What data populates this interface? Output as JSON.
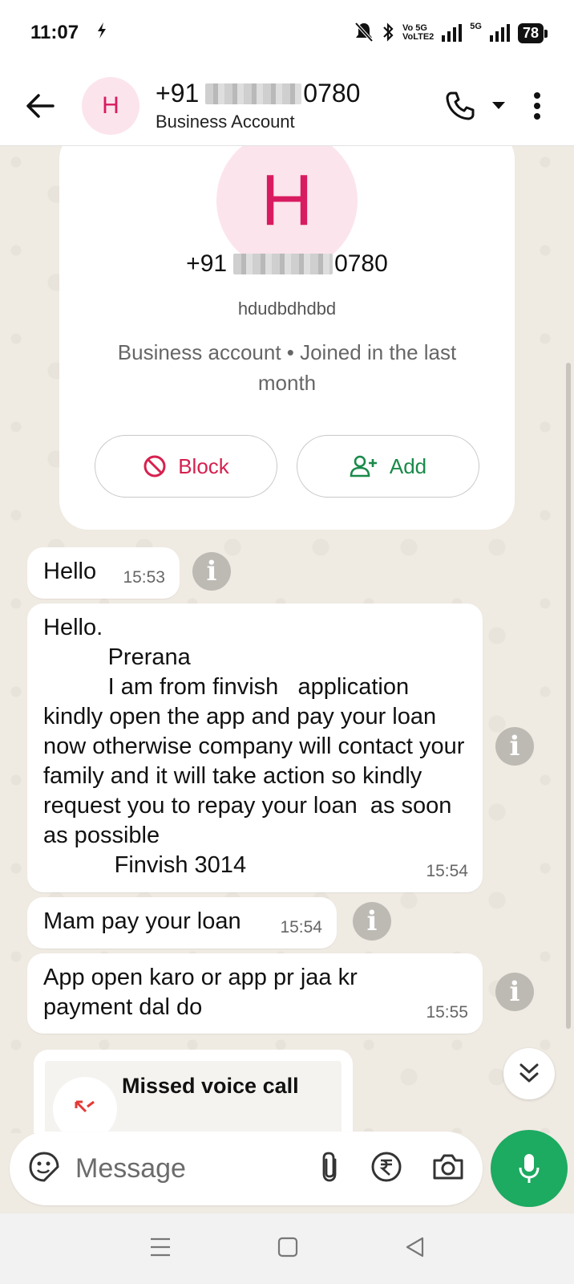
{
  "status_bar": {
    "time": "11:07",
    "network_label": "Vo 5G\nVoLTE2",
    "network_type": "5G",
    "battery": "78"
  },
  "header": {
    "phone_prefix": "+91",
    "phone_suffix": "0780",
    "subtitle": "Business Account",
    "avatar_letter": "H"
  },
  "profile_card": {
    "avatar_letter": "H",
    "phone_prefix": "+91",
    "phone_suffix": "0780",
    "username": "hdudbdhdbd",
    "info": "Business account • Joined in the last month",
    "block_label": "Block",
    "add_label": "Add"
  },
  "messages": [
    {
      "text": "Hello",
      "time": "15:53"
    },
    {
      "text": "Hello.\n          Prerana \n          I am from finvish   application \nkindly open the app and pay your loan now otherwise company will contact your family and it will take action so kindly request you to repay your loan  as soon as possible \n           Finvish 3014",
      "time": "15:54"
    },
    {
      "text": "Mam pay your loan",
      "time": "15:54"
    },
    {
      "text": "App open karo or app pr jaa kr payment dal do",
      "time": "15:55"
    }
  ],
  "missed_call": {
    "label": "Missed voice call"
  },
  "composer": {
    "placeholder": "Message"
  },
  "colors": {
    "accent_green": "#1daa61",
    "block_red": "#d6214f",
    "add_green": "#1a8a4a",
    "avatar_bg": "#fce4ec",
    "avatar_fg": "#d81b60",
    "chat_bg": "#efeae2"
  },
  "icons": [
    "back-arrow-icon",
    "phone-icon",
    "dropdown-caret-icon",
    "more-vert-icon",
    "block-icon",
    "add-contact-icon",
    "info-icon",
    "double-chevron-down-icon",
    "missed-call-icon",
    "sticker-icon",
    "paperclip-icon",
    "rupee-icon",
    "camera-icon",
    "mic-icon",
    "nav-menu-icon",
    "nav-home-icon",
    "nav-back-icon",
    "silent-icon",
    "bluetooth-icon",
    "flash-icon"
  ]
}
